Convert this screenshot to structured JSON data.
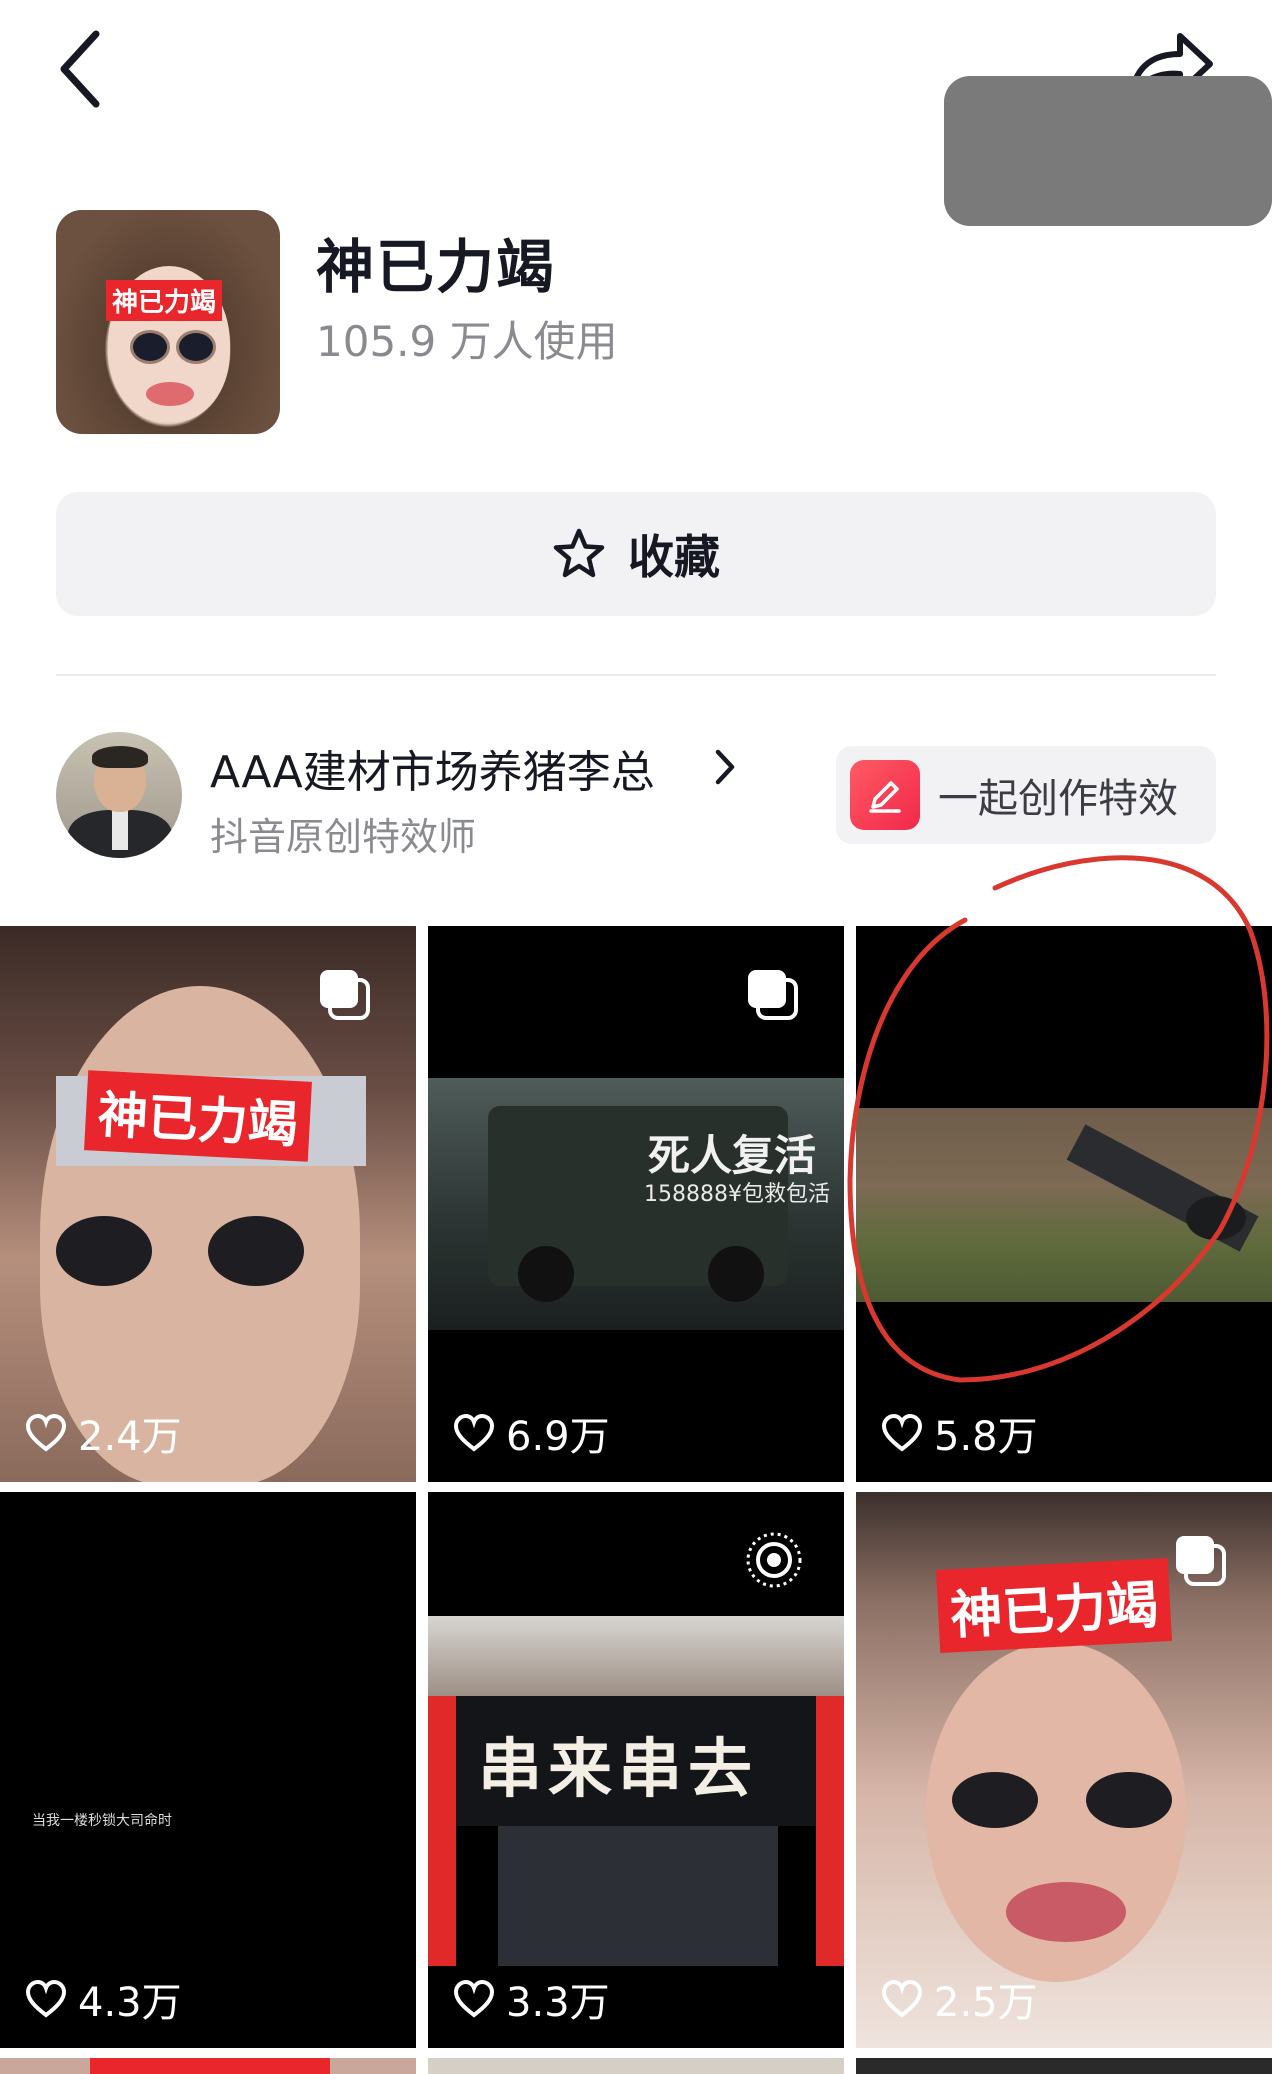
{
  "header": {
    "back_icon": "chevron-left-icon",
    "share_icon": "share-arrow-icon"
  },
  "effect": {
    "name": "神已力竭",
    "usage": "105.9 万人使用",
    "thumb_tag": "神已力竭"
  },
  "favorite": {
    "label": "收藏",
    "icon": "star-outline-icon"
  },
  "creator": {
    "name": "AAA建材市场养猪李总",
    "title": "抖音原创特效师",
    "co_create_label": "一起创作特效",
    "co_create_icon": "edit-pen-icon"
  },
  "colors": {
    "accent_red": "#e8262b",
    "annotation_red": "#d9382f",
    "button_bg": "#f2f2f4"
  },
  "videos": [
    {
      "likes": "2.4万",
      "overlay_text": "神已力竭",
      "badge": "multi-image-icon"
    },
    {
      "likes": "6.9万",
      "overlay_text": "死人复活",
      "overlay_sub": "158888¥包救包活",
      "badge": "multi-image-icon"
    },
    {
      "likes": "5.8万"
    },
    {
      "likes": "4.3万",
      "overlay_text": "当我一楼秒锁大司命时"
    },
    {
      "likes": "3.3万",
      "overlay_text": "串来串去",
      "badge": "live-icon"
    },
    {
      "likes": "2.5万",
      "overlay_text": "神已力竭",
      "badge": "multi-image-icon"
    }
  ]
}
